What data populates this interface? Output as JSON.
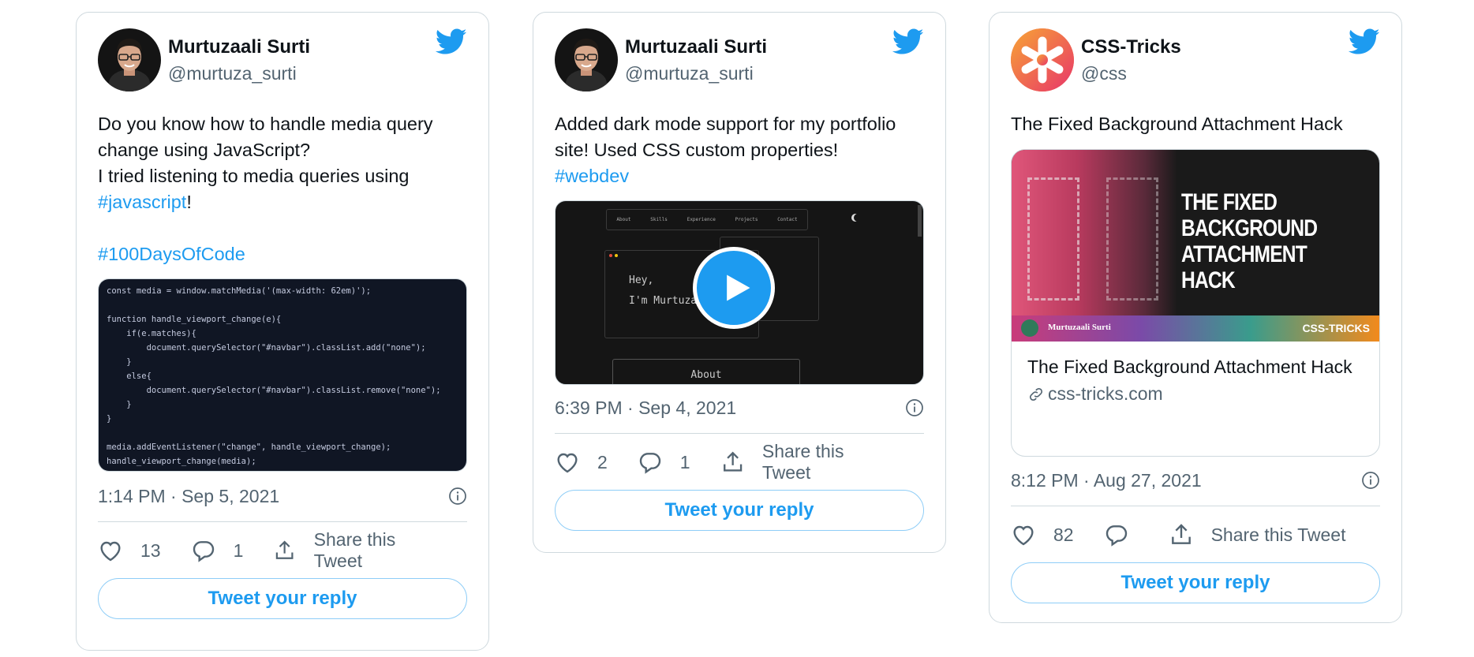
{
  "tweets": [
    {
      "author": {
        "name": "Murtuzaali Surti",
        "handle": "@murtuza_surti"
      },
      "text": "Do you know how to handle media query change using JavaScript?\nI tried listening to media queries using ",
      "hashtag1": "#javascript",
      "after_hashtag": "!",
      "hashtag2": "#100DaysOfCode",
      "code_lines": [
        "const media = window.matchMedia('(max-width: 62em)');",
        "",
        "function handle_viewport_change(e){",
        "    if(e.matches){",
        "        document.querySelector(\"#navbar\").classList.add(\"none\");",
        "    }",
        "    else{",
        "        document.querySelector(\"#navbar\").classList.remove(\"none\");",
        "    }",
        "}",
        "",
        "media.addEventListener(\"change\", handle_viewport_change);",
        "handle_viewport_change(media);"
      ],
      "timestamp": "1:14 PM · Sep 5, 2021",
      "likes": "13",
      "replies": "1",
      "share_label": "Share this Tweet",
      "reply_button": "Tweet your reply"
    },
    {
      "author": {
        "name": "Murtuzaali Surti",
        "handle": "@murtuza_surti"
      },
      "text": "Added dark mode support for my portfolio site! Used CSS custom properties!",
      "hashtag": "#webdev",
      "video": {
        "nav": [
          "About",
          "Skills",
          "Experience",
          "Projects",
          "Contact"
        ],
        "hey": "Hey,",
        "im": "I'm Murtuza",
        "about": "About"
      },
      "timestamp": "6:39 PM · Sep 4, 2021",
      "likes": "2",
      "replies": "1",
      "share_label": "Share this Tweet",
      "reply_button": "Tweet your reply"
    },
    {
      "author": {
        "name": "CSS-Tricks",
        "handle": "@css"
      },
      "text": "The Fixed Background Attachment Hack",
      "card": {
        "image_headline": [
          "THE FIXED",
          "BACKGROUND",
          "ATTACHMENT HACK"
        ],
        "image_author": "Murtuzaali Surti",
        "image_brand": "CSS-TRICKS",
        "title": "The Fixed Background Attachment Hack",
        "domain": "css-tricks.com"
      },
      "timestamp": "8:12 PM · Aug 27, 2021",
      "likes": "82",
      "share_label": "Share this Tweet",
      "reply_button": "Tweet your reply"
    }
  ],
  "colors": {
    "accent": "#1d9bf0",
    "border": "#cfd9de",
    "muted": "#536471"
  }
}
